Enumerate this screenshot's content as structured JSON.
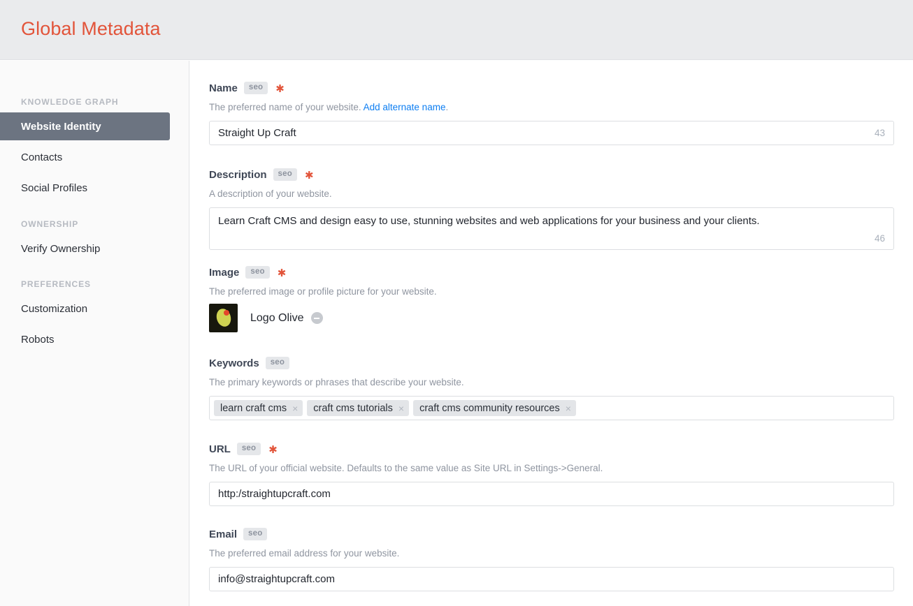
{
  "header": {
    "title": "Global Metadata"
  },
  "sidebar": {
    "groups": [
      {
        "heading": "KNOWLEDGE GRAPH",
        "items": [
          {
            "label": "Website Identity",
            "active": true
          },
          {
            "label": "Contacts",
            "active": false
          },
          {
            "label": "Social Profiles",
            "active": false
          }
        ]
      },
      {
        "heading": "OWNERSHIP",
        "items": [
          {
            "label": "Verify Ownership",
            "active": false
          }
        ]
      },
      {
        "heading": "PREFERENCES",
        "items": [
          {
            "label": "Customization",
            "active": false
          },
          {
            "label": "Robots",
            "active": false
          }
        ]
      }
    ]
  },
  "fields": {
    "name": {
      "label": "Name",
      "badge": "seo",
      "required": true,
      "instructions_before": "The preferred name of your website. ",
      "instructions_link": "Add alternate name",
      "instructions_after": ".",
      "value": "Straight Up Craft",
      "counter": "43"
    },
    "description": {
      "label": "Description",
      "badge": "seo",
      "required": true,
      "instructions": "A description of your website.",
      "value": "Learn Craft CMS and design easy to use, stunning websites and web applications for your business and your clients.",
      "counter": "46"
    },
    "image": {
      "label": "Image",
      "badge": "seo",
      "required": true,
      "instructions": "The preferred image or profile picture for your website.",
      "asset_name": "Logo Olive",
      "remove_icon": "minus-circle-icon",
      "thumb_bg": "#17170d",
      "olive_color": "#cfd352",
      "pimento_color": "#e4452b"
    },
    "keywords": {
      "label": "Keywords",
      "badge": "seo",
      "required": false,
      "instructions": "The primary keywords or phrases that describe your website.",
      "tags": [
        "learn craft cms",
        "craft cms tutorials",
        "craft cms community resources"
      ],
      "tag_remove_glyph": "×"
    },
    "url": {
      "label": "URL",
      "badge": "seo",
      "required": true,
      "instructions": "The URL of your official website. Defaults to the same value as Site URL in Settings->General.",
      "value": "http:/straightupcraft.com"
    },
    "email": {
      "label": "Email",
      "badge": "seo",
      "required": false,
      "instructions": "The preferred email address for your website.",
      "value": "info@straightupcraft.com"
    }
  },
  "colors": {
    "accent": "#e2543a",
    "link": "#0d7ef2",
    "active_nav": "#6c7481",
    "header_bg": "#eaebed"
  },
  "glyphs": {
    "required_star": "✱"
  }
}
